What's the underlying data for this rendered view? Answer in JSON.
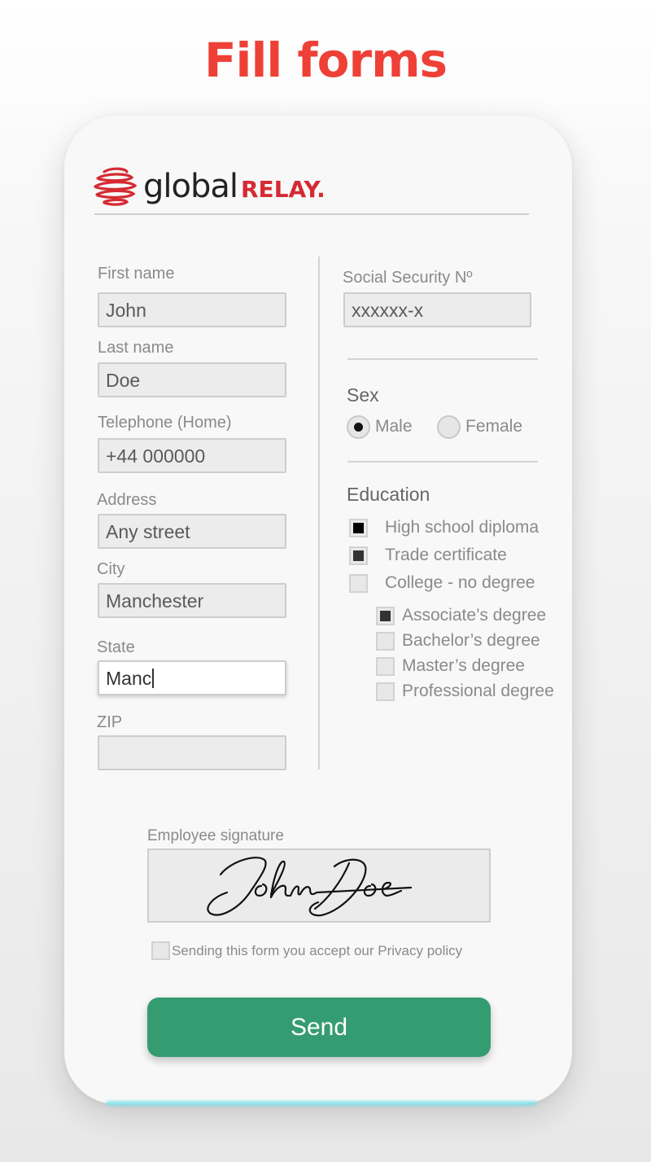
{
  "headline": "Fill forms",
  "brand": {
    "part1": "global",
    "part2": "RELAY.",
    "accent_color": "#d52a33"
  },
  "left_column": {
    "first_name": {
      "label": "First name",
      "value": "John"
    },
    "last_name": {
      "label": "Last name",
      "value": "Doe"
    },
    "telephone": {
      "label": "Telephone (Home)",
      "value": "+44 000000"
    },
    "address": {
      "label": "Address",
      "value": "Any street"
    },
    "city": {
      "label": "City",
      "value": "Manchester"
    },
    "state": {
      "label": "State",
      "value": "Manc"
    },
    "zip": {
      "label": "ZIP",
      "value": ""
    }
  },
  "right_column": {
    "ssn": {
      "label": "Social Security Nº",
      "value": "xxxxxx-x"
    },
    "sex": {
      "title": "Sex",
      "options": [
        {
          "label": "Male",
          "selected": true
        },
        {
          "label": "Female",
          "selected": false
        }
      ]
    },
    "education": {
      "title": "Education",
      "options": [
        {
          "label": "High school diploma",
          "checked": true
        },
        {
          "label": "Trade certificate",
          "checked": true
        },
        {
          "label": "College - no degree",
          "checked": false
        }
      ],
      "sub_options": [
        {
          "label": "Associate’s degree",
          "checked": true
        },
        {
          "label": "Bachelor’s degree",
          "checked": false
        },
        {
          "label": "Master’s degree",
          "checked": false
        },
        {
          "label": "Professional degree",
          "checked": false
        }
      ]
    }
  },
  "signature": {
    "label": "Employee signature",
    "signed_name": "John Doe"
  },
  "privacy": {
    "text": "Sending this form you accept our Privacy policy",
    "checked": false
  },
  "send_button": {
    "label": "Send",
    "color": "#359c71"
  },
  "headline_color": "#ee4036"
}
